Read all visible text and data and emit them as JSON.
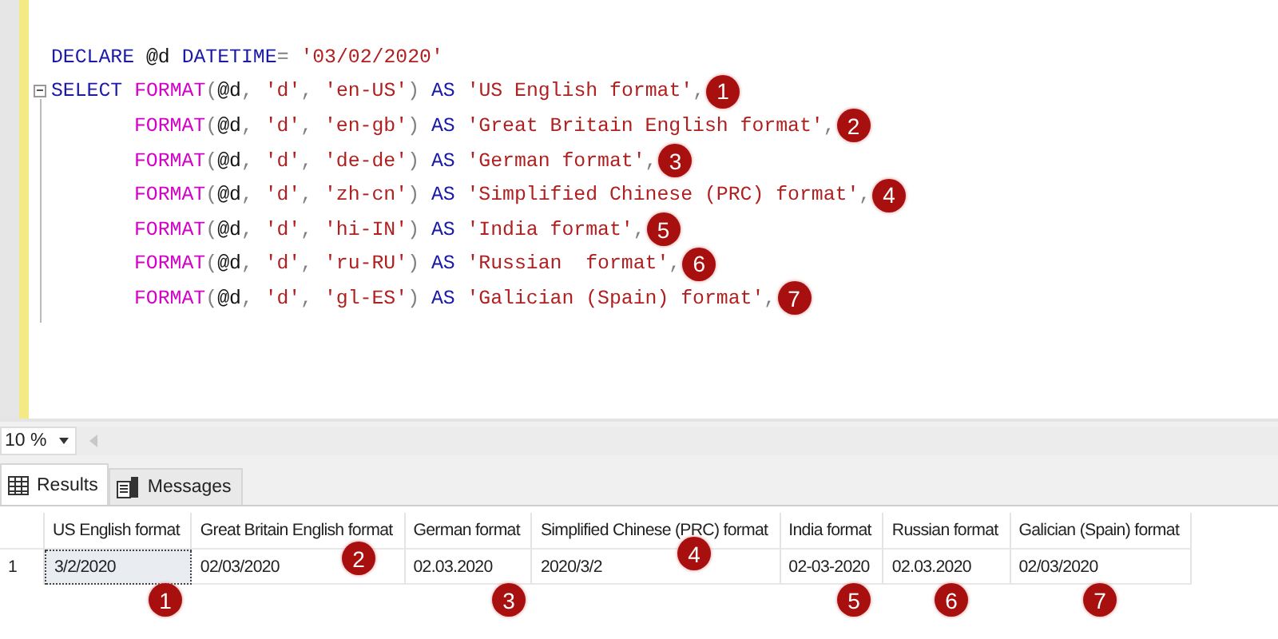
{
  "editor": {
    "lines": [
      {
        "indented": false,
        "foldable": false,
        "tokens": [
          {
            "kind": "keyword",
            "text": "DECLARE"
          },
          {
            "kind": "plain",
            "text": " @d "
          },
          {
            "kind": "keyword",
            "text": "DATETIME"
          },
          {
            "kind": "punct",
            "text": "= "
          },
          {
            "kind": "string",
            "text": "'03/02/2020'"
          }
        ]
      },
      {
        "indented": false,
        "foldable": true,
        "badge": "1",
        "tokens": [
          {
            "kind": "keyword",
            "text": "SELECT "
          },
          {
            "kind": "function",
            "text": "FORMAT"
          },
          {
            "kind": "punct",
            "text": "("
          },
          {
            "kind": "plain",
            "text": "@d"
          },
          {
            "kind": "punct",
            "text": ", "
          },
          {
            "kind": "string",
            "text": "'d'"
          },
          {
            "kind": "punct",
            "text": ", "
          },
          {
            "kind": "string",
            "text": "'en-US'"
          },
          {
            "kind": "punct",
            "text": ") "
          },
          {
            "kind": "keyword",
            "text": "AS "
          },
          {
            "kind": "string",
            "text": "'US English format'"
          },
          {
            "kind": "punct",
            "text": ","
          }
        ]
      },
      {
        "indented": true,
        "foldable": false,
        "badge": "2",
        "tokens": [
          {
            "kind": "function",
            "text": "FORMAT"
          },
          {
            "kind": "punct",
            "text": "("
          },
          {
            "kind": "plain",
            "text": "@d"
          },
          {
            "kind": "punct",
            "text": ", "
          },
          {
            "kind": "string",
            "text": "'d'"
          },
          {
            "kind": "punct",
            "text": ", "
          },
          {
            "kind": "string",
            "text": "'en-gb'"
          },
          {
            "kind": "punct",
            "text": ") "
          },
          {
            "kind": "keyword",
            "text": "AS "
          },
          {
            "kind": "string",
            "text": "'Great Britain English format'"
          },
          {
            "kind": "punct",
            "text": ","
          }
        ]
      },
      {
        "indented": true,
        "foldable": false,
        "badge": "3",
        "tokens": [
          {
            "kind": "function",
            "text": "FORMAT"
          },
          {
            "kind": "punct",
            "text": "("
          },
          {
            "kind": "plain",
            "text": "@d"
          },
          {
            "kind": "punct",
            "text": ", "
          },
          {
            "kind": "string",
            "text": "'d'"
          },
          {
            "kind": "punct",
            "text": ", "
          },
          {
            "kind": "string",
            "text": "'de-de'"
          },
          {
            "kind": "punct",
            "text": ") "
          },
          {
            "kind": "keyword",
            "text": "AS "
          },
          {
            "kind": "string",
            "text": "'German format'"
          },
          {
            "kind": "punct",
            "text": ","
          }
        ]
      },
      {
        "indented": true,
        "foldable": false,
        "badge": "4",
        "tokens": [
          {
            "kind": "function",
            "text": "FORMAT"
          },
          {
            "kind": "punct",
            "text": "("
          },
          {
            "kind": "plain",
            "text": "@d"
          },
          {
            "kind": "punct",
            "text": ", "
          },
          {
            "kind": "string",
            "text": "'d'"
          },
          {
            "kind": "punct",
            "text": ", "
          },
          {
            "kind": "string",
            "text": "'zh-cn'"
          },
          {
            "kind": "punct",
            "text": ") "
          },
          {
            "kind": "keyword",
            "text": "AS "
          },
          {
            "kind": "string",
            "text": "'Simplified Chinese (PRC) format'"
          },
          {
            "kind": "punct",
            "text": ","
          }
        ]
      },
      {
        "indented": true,
        "foldable": false,
        "badge": "5",
        "tokens": [
          {
            "kind": "function",
            "text": "FORMAT"
          },
          {
            "kind": "punct",
            "text": "("
          },
          {
            "kind": "plain",
            "text": "@d"
          },
          {
            "kind": "punct",
            "text": ", "
          },
          {
            "kind": "string",
            "text": "'d'"
          },
          {
            "kind": "punct",
            "text": ", "
          },
          {
            "kind": "string",
            "text": "'hi-IN'"
          },
          {
            "kind": "punct",
            "text": ") "
          },
          {
            "kind": "keyword",
            "text": "AS "
          },
          {
            "kind": "string",
            "text": "'India format'"
          },
          {
            "kind": "punct",
            "text": ","
          }
        ]
      },
      {
        "indented": true,
        "foldable": false,
        "badge": "6",
        "tokens": [
          {
            "kind": "function",
            "text": "FORMAT"
          },
          {
            "kind": "punct",
            "text": "("
          },
          {
            "kind": "plain",
            "text": "@d"
          },
          {
            "kind": "punct",
            "text": ", "
          },
          {
            "kind": "string",
            "text": "'d'"
          },
          {
            "kind": "punct",
            "text": ", "
          },
          {
            "kind": "string",
            "text": "'ru-RU'"
          },
          {
            "kind": "punct",
            "text": ") "
          },
          {
            "kind": "keyword",
            "text": "AS "
          },
          {
            "kind": "string",
            "text": "'Russian  format'"
          },
          {
            "kind": "punct",
            "text": ","
          }
        ]
      },
      {
        "indented": true,
        "foldable": false,
        "badge": "7",
        "tokens": [
          {
            "kind": "function",
            "text": "FORMAT"
          },
          {
            "kind": "punct",
            "text": "("
          },
          {
            "kind": "plain",
            "text": "@d"
          },
          {
            "kind": "punct",
            "text": ", "
          },
          {
            "kind": "string",
            "text": "'d'"
          },
          {
            "kind": "punct",
            "text": ", "
          },
          {
            "kind": "string",
            "text": "'gl-ES'"
          },
          {
            "kind": "punct",
            "text": ") "
          },
          {
            "kind": "keyword",
            "text": "AS "
          },
          {
            "kind": "string",
            "text": "'Galician (Spain) format'"
          },
          {
            "kind": "punct",
            "text": ","
          }
        ]
      }
    ]
  },
  "zoom": {
    "value": "10 %"
  },
  "tabs": [
    {
      "label": "Results",
      "selected": true
    },
    {
      "label": "Messages",
      "selected": false
    }
  ],
  "grid": {
    "columns": [
      "US English format",
      "Great Britain English format",
      "German format",
      "Simplified Chinese (PRC) format",
      "India format",
      "Russian  format",
      "Galician (Spain) format"
    ],
    "rows": [
      {
        "row_number": "1",
        "cells": [
          {
            "text": "3/2/2020",
            "selected": true
          },
          {
            "text": "02/03/2020",
            "selected": false
          },
          {
            "text": "02.03.2020",
            "selected": false
          },
          {
            "text": "2020/3/2",
            "selected": false
          },
          {
            "text": "02-03-2020",
            "selected": false
          },
          {
            "text": "02.03.2020",
            "selected": false
          },
          {
            "text": "02/03/2020",
            "selected": false
          }
        ]
      }
    ]
  },
  "grid_badges": [
    "1",
    "2",
    "3",
    "4",
    "5",
    "6",
    "7"
  ]
}
